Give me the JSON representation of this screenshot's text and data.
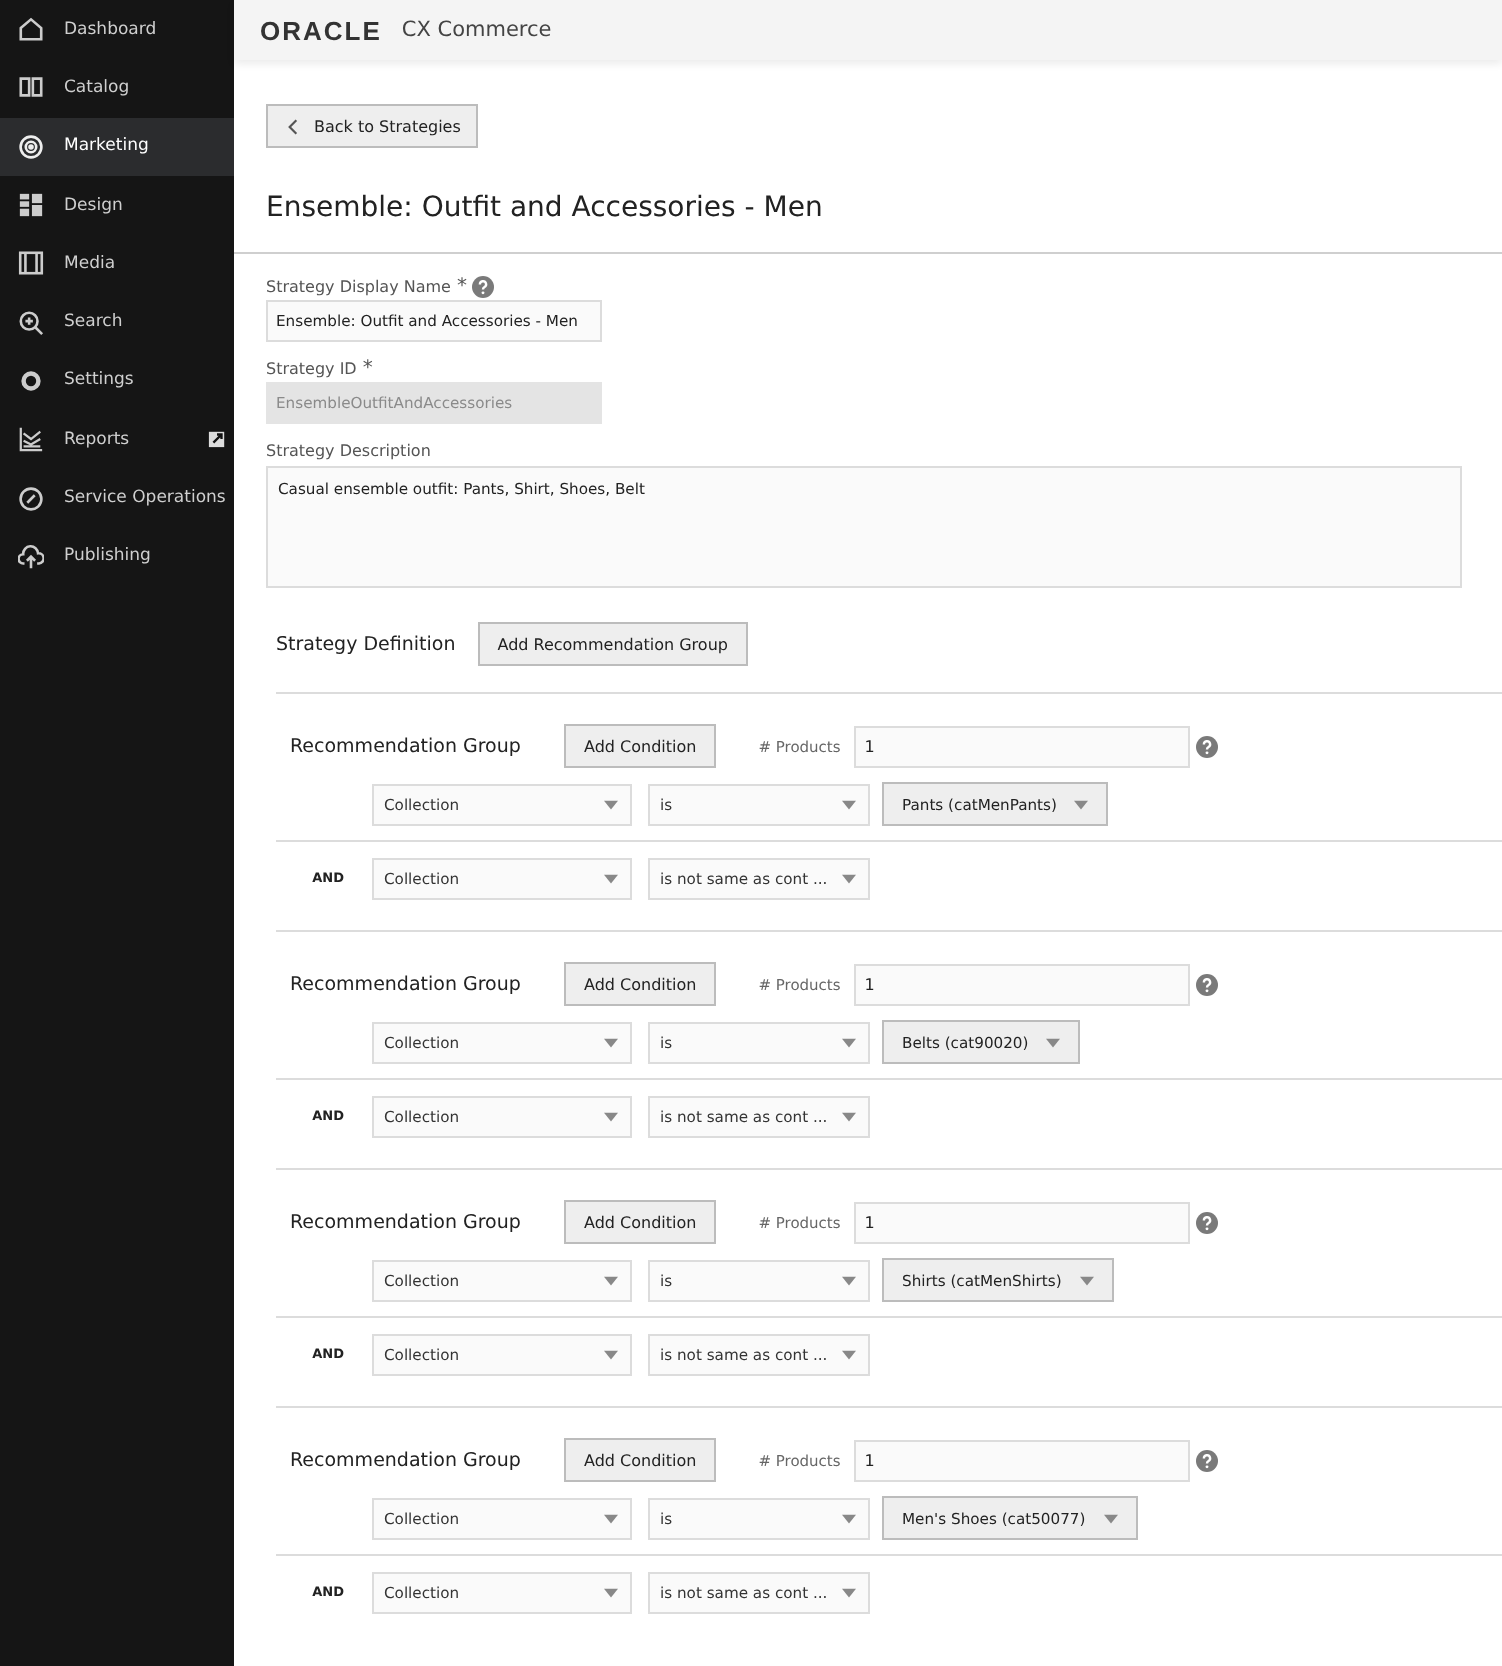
{
  "sidebar": {
    "items": [
      {
        "label": "Dashboard",
        "selected": false,
        "external": false
      },
      {
        "label": "Catalog",
        "selected": false,
        "external": false
      },
      {
        "label": "Marketing",
        "selected": true,
        "external": false
      },
      {
        "label": "Design",
        "selected": false,
        "external": false
      },
      {
        "label": "Media",
        "selected": false,
        "external": false
      },
      {
        "label": "Search",
        "selected": false,
        "external": false
      },
      {
        "label": "Settings",
        "selected": false,
        "external": false
      },
      {
        "label": "Reports",
        "selected": false,
        "external": true
      },
      {
        "label": "Service Operations",
        "selected": false,
        "external": false
      },
      {
        "label": "Publishing",
        "selected": false,
        "external": false
      }
    ]
  },
  "header": {
    "brand": "ORACLE",
    "product": "CX Commerce"
  },
  "back_button": "Back to Strategies",
  "title": "Ensemble: Outfit and Accessories - Men",
  "form": {
    "fields": [
      {
        "label": "Strategy Display Name",
        "required_mark": "*",
        "help": true,
        "value": "Ensemble: Outfit and Accessories - Men",
        "disabled": false,
        "kind": "input"
      },
      {
        "label": "Strategy ID",
        "required_mark": "*",
        "value": "EnsembleOutfitAndAccessories",
        "disabled": true,
        "kind": "input"
      },
      {
        "label": "Strategy Description",
        "value": "Casual ensemble outfit: Pants, Shirt, Shoes, Belt",
        "kind": "textarea"
      }
    ]
  },
  "definition": {
    "label": "Strategy Definition",
    "add_button": "Add Recommendation Group"
  },
  "groups": [
    {
      "label": "Recommendation Group",
      "add_button": "Add Condition",
      "products_label": "# Products",
      "products": "1",
      "conditions": [
        {
          "attribute": "Collection",
          "operator": "is",
          "value": "Pants (catMenPants)"
        },
        {
          "connector": "AND",
          "attribute": "Collection",
          "operator": "is not same as cont ..."
        }
      ]
    },
    {
      "label": "Recommendation Group",
      "add_button": "Add Condition",
      "products_label": "# Products",
      "products": "1",
      "conditions": [
        {
          "attribute": "Collection",
          "operator": "is",
          "value": "Belts (cat90020)"
        },
        {
          "connector": "AND",
          "attribute": "Collection",
          "operator": "is not same as cont ..."
        }
      ]
    },
    {
      "label": "Recommendation Group",
      "add_button": "Add Condition",
      "products_label": "# Products",
      "products": "1",
      "conditions": [
        {
          "attribute": "Collection",
          "operator": "is",
          "value": "Shirts (catMenShirts)"
        },
        {
          "connector": "AND",
          "attribute": "Collection",
          "operator": "is not same as cont ..."
        }
      ]
    },
    {
      "label": "Recommendation Group",
      "add_button": "Add Condition",
      "products_label": "# Products",
      "products": "1",
      "conditions": [
        {
          "attribute": "Collection",
          "operator": "is",
          "value": "Men's Shoes (cat50077)"
        },
        {
          "connector": "AND",
          "attribute": "Collection",
          "operator": "is not same as cont ..."
        }
      ]
    }
  ]
}
